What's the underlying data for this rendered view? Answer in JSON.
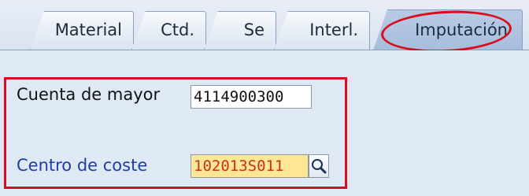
{
  "tabs": [
    {
      "label": "Material",
      "active": false
    },
    {
      "label": "Ctd.",
      "active": false
    },
    {
      "label": "Se",
      "active": false
    },
    {
      "label": "Interl.",
      "active": false
    },
    {
      "label": "Imputación",
      "active": true
    }
  ],
  "form": {
    "cuenta_label": "Cuenta de mayor",
    "cuenta_value": "4114900300",
    "centro_label": "Centro de coste",
    "centro_value": "102013S011"
  },
  "colors": {
    "highlight_annotation": "#d90d1c",
    "required_field_bg": "#fde795",
    "label_link": "#1f3f9e"
  },
  "icons": {
    "search_help": "magnifier-icon"
  }
}
